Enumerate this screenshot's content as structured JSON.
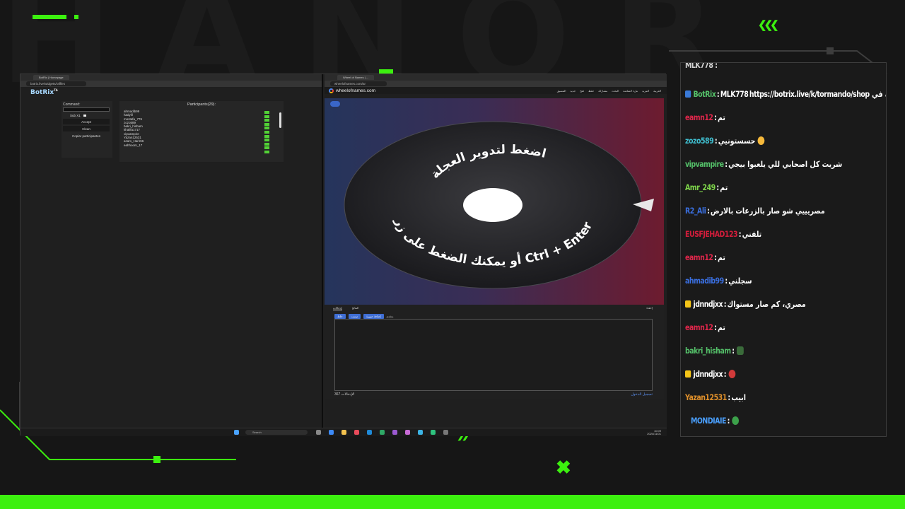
{
  "colors": {
    "accent": "#3cf00f",
    "background": "#161616"
  },
  "botrix": {
    "tab_title": "BotRix | Homepage",
    "url": "botrix.live/widgets/raffles",
    "logo": "BotRix",
    "logo_sup": "TA",
    "command_label": "Command:",
    "sub_label": "Sub X1",
    "accept_label": "Accept",
    "clean_label": "Clean",
    "copy_label": "Copiar participantes",
    "participants_title": "Participants(29):",
    "participants": [
      "ahmadib99",
      "hadylil",
      "mostafa_776",
      "zozo589",
      "bakri_hisham",
      "khalifa1717",
      "vipvampire",
      "Yazan12531",
      "azam_Harir66",
      "eahhoom_17"
    ]
  },
  "wheel": {
    "tab_title": "Wheel of Names | ...",
    "url": "wheelofnames.com/ar",
    "site_name": "wheelofnames.com",
    "menu": [
      "التنسيق",
      "جديد",
      "فتح",
      "حفظ",
      "مشاركة",
      "البحث",
      "ملء الشاشة",
      "المزيد",
      "العربية"
    ],
    "spin_text_top": "اضغط لتدوير العجلة",
    "spin_text_bottom": "أو يمكنك الضغط على زر Ctrl + Enter",
    "tab_entries": "إدخالات",
    "tab_results": "النتائج",
    "hide_label": "إخفاء",
    "btn_shuffle": "خلط",
    "btn_sort": "ترتيب",
    "btn_add_image": "إضافة صورة",
    "advanced_label": "متقدم",
    "count_label": "الإدخالات",
    "count_value": "367",
    "login_link": "تسجيل الدخول"
  },
  "taskbar": {
    "search_label": "Search",
    "time": "10:09",
    "date": "2024/11/01"
  },
  "chat": {
    "messages": [
      {
        "user": "MLK778",
        "badge": "BotRix",
        "color": "#ffffff",
        "msg": "يمكنك رؤية متجر القناة في https://botrix.live/k/tormando/shop"
      },
      {
        "user": "eamn12",
        "color": "#e0264b",
        "msg": "تم"
      },
      {
        "user": "zozo589",
        "color": "#3fbfd0",
        "msg": "حسستونيي"
      },
      {
        "user": "vipvampire",
        "color": "#55c26a",
        "msg": "شريت كل اصحابي للي يلعبوا بيجي"
      },
      {
        "user": "Amr_249",
        "color": "#7ed64a",
        "msg": "تم"
      },
      {
        "user": "R2_Ali",
        "color": "#3a6fe0",
        "msg": "مصريييي شو صار بالزرعات بالارض"
      },
      {
        "user": "EUSFJEHAD123",
        "color": "#d31d3b",
        "msg": "تلفني"
      },
      {
        "user": "eamn12",
        "color": "#e0264b",
        "msg": "تم"
      },
      {
        "user": "ahmadib99",
        "color": "#3a6fe0",
        "msg": "سجلني"
      },
      {
        "user": "jdnndjxx",
        "color": "#f5c518",
        "msg": "مصري، كم صار مستواك"
      },
      {
        "user": "eamn12",
        "color": "#e0264b",
        "msg": "تم"
      },
      {
        "user": "bakri_hisham",
        "color": "#55c26a",
        "msg": ""
      },
      {
        "user": "jdnndjxx",
        "color": "#f5c518",
        "msg": ""
      },
      {
        "user": "Yazan12531",
        "color": "#e0902a",
        "msg": "ابيب"
      },
      {
        "user": "MONDIAIE",
        "color": "#4aa0ff",
        "msg": ""
      }
    ]
  }
}
